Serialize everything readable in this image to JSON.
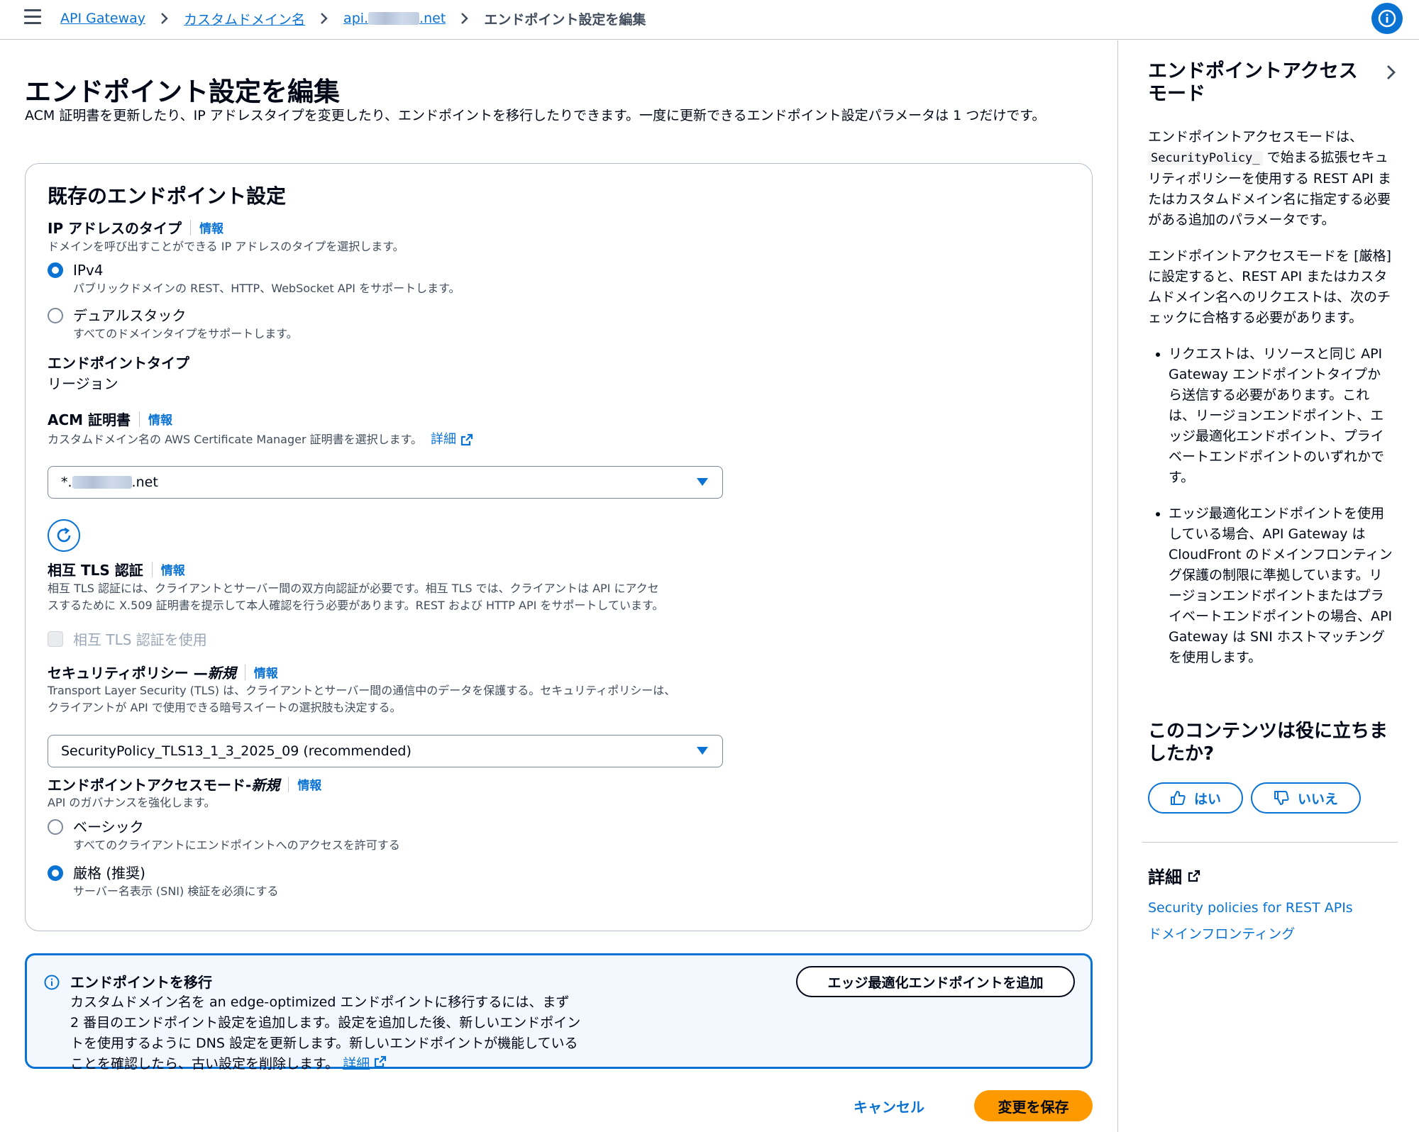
{
  "breadcrumbs": {
    "api_gateway": "API Gateway",
    "custom_domain": "カスタムドメイン名",
    "domain_prefix": "api.",
    "domain_suffix": ".net",
    "current": "エンドポイント設定を編集"
  },
  "page": {
    "title": "エンドポイント設定を編集",
    "description": "ACM 証明書を更新したり、IP アドレスタイプを変更したり、エンドポイントを移行したりできます。一度に更新できるエンドポイント設定パラメータは 1 つだけです。"
  },
  "card": {
    "title": "既存のエンドポイント設定",
    "info_label": "情報",
    "ip_type": {
      "label": "IP アドレスのタイプ",
      "description": "ドメインを呼び出すことができる IP アドレスのタイプを選択します。",
      "options": [
        {
          "label": "IPv4",
          "description": "パブリックドメインの REST、HTTP、WebSocket API をサポートします。",
          "selected": true
        },
        {
          "label": "デュアルスタック",
          "description": "すべてのドメインタイプをサポートします。",
          "selected": false
        }
      ]
    },
    "endpoint_type": {
      "label": "エンドポイントタイプ",
      "value": "リージョン"
    },
    "acm": {
      "label": "ACM 証明書",
      "description": "カスタムドメイン名の AWS Certificate Manager 証明書を選択します。",
      "details_link": "詳細",
      "value_prefix": "*.",
      "value_suffix": ".net"
    },
    "mtls": {
      "label": "相互 TLS 認証",
      "description_line1": "相互 TLS 認証には、クライアントとサーバー間の双方向認証が必要です。相互 TLS では、クライアントは API にアクセ",
      "description_line2": "スするために X.509 証明書を提示して本人確認を行う必要があります。REST および HTTP API をサポートしています。",
      "checkbox_label": "相互 TLS 認証を使用",
      "checked": false
    },
    "security_policy": {
      "label": "セキュリティポリシー — ",
      "label_new": "新規",
      "description_line1": "Transport Layer Security (TLS) は、クライアントとサーバー間の通信中のデータを保護する。セキュリティポリシーは、",
      "description_line2": "クライアントが API で使用できる暗号スイートの選択肢も決定する。",
      "value": "SecurityPolicy_TLS13_1_3_2025_09 (recommended)"
    },
    "access_mode": {
      "label": "エンドポイントアクセスモード- ",
      "label_new": "新規",
      "description": "API のガバナンスを強化します。",
      "options": [
        {
          "label": "ベーシック",
          "description": "すべてのクライアントにエンドポイントへのアクセスを許可する",
          "selected": false
        },
        {
          "label": "厳格 (推奨)",
          "description": "サーバー名表示 (SNI) 検証を必須にする",
          "selected": true
        }
      ]
    }
  },
  "alert": {
    "title": "エンドポイントを移行",
    "body": "カスタムドメイン名を an edge-optimized エンドポイントに移行するには、まず 2 番目のエンドポイント設定を追加します。設定を追加した後、新しいエンドポイントを使用するように DNS 設定を更新します。新しいエンドポイントが機能していることを確認したら、古い設定を削除します。",
    "details_link": "詳細",
    "button": "エッジ最適化エンドポイントを追加"
  },
  "actions": {
    "cancel": "キャンセル",
    "save": "変更を保存"
  },
  "help_panel": {
    "title": "エンドポイントアクセスモード",
    "p1_before": "エンドポイントアクセスモードは、",
    "p1_code": "SecurityPolicy_",
    "p1_after": " で始まる拡張セキュリティポリシーを使用する REST API またはカスタムドメイン名に指定する必要がある追加のパラメータです。",
    "p2": "エンドポイントアクセスモードを [厳格] に設定すると、REST API またはカスタムドメイン名へのリクエストは、次のチェックに合格する必要があります。",
    "bullets": [
      "リクエストは、リソースと同じ API Gateway エンドポイントタイプから送信する必要があります。これは、リージョンエンドポイント、エッジ最適化エンドポイント、プライベートエンドポイントのいずれかです。",
      "エッジ最適化エンドポイントを使用している場合、API Gateway は CloudFront のドメインフロンティング保護の制限に準拠しています。リージョンエンドポイントまたはプライベートエンドポイントの場合、API Gateway は SNI ホストマッチングを使用します。"
    ],
    "feedback_title": "このコンテンツは役に立ちましたか?",
    "yes": "はい",
    "no": "いいえ",
    "more_title": "詳細",
    "links": [
      "Security policies for REST APIs",
      "ドメインフロンティング"
    ]
  },
  "colors": {
    "accent": "#0972d3",
    "primary_button": "#ff9900",
    "alert_bg": "#f2f8fd"
  }
}
